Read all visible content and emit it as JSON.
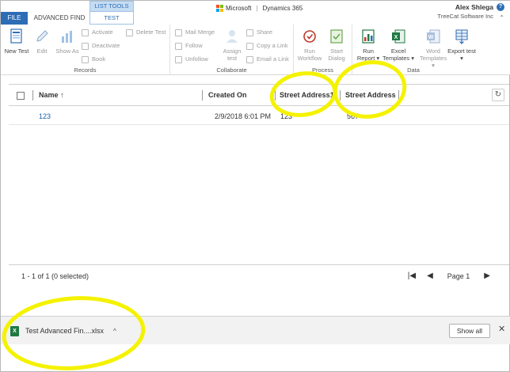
{
  "tabs": {
    "file": "FILE",
    "advanced_find": "ADVANCED FIND",
    "list_tools": "LIST TOOLS",
    "test": "TEST"
  },
  "brand": {
    "company": "Microsoft",
    "product": "Dynamics 365"
  },
  "user": {
    "name": "Alex Shlega",
    "org": "TreeCat Software Inc",
    "help": "?"
  },
  "ribbon": {
    "records": {
      "label": "Records",
      "new": "New Test",
      "edit": "Edit",
      "show_as": "Show As",
      "activate": "Activate",
      "deactivate": "Deactivate",
      "book": "Book",
      "delete": "Delete Test"
    },
    "collaborate": {
      "label": "Collaborate",
      "mail_merge": "Mail Merge",
      "follow": "Follow",
      "unfollow": "Unfollow",
      "assign": "Assign test",
      "share": "Share",
      "copy_link": "Copy a Link",
      "email_link": "Email a Link"
    },
    "process": {
      "label": "Process",
      "run_workflow": "Run Workflow",
      "start_dialog": "Start Dialog"
    },
    "data": {
      "label": "Data",
      "run_report": "Run Report",
      "excel_templates": "Excel Templates",
      "word_templates": "Word Templates",
      "export_test": "Export test"
    }
  },
  "grid": {
    "columns": [
      "Name ↑",
      "Created On",
      "Street Address1",
      "Street Address"
    ],
    "rows": [
      {
        "name": "123",
        "created_on": "2/9/2018 6:01 PM",
        "street1": "123",
        "street2": "567"
      }
    ],
    "status": "1 - 1 of 1 (0 selected)",
    "page": "Page 1"
  },
  "download": {
    "file": "Test Advanced Fin....xlsx",
    "show_all": "Show all",
    "close": "✕"
  },
  "colors": {
    "accent": "#2d6db5",
    "annotation": "#f5f200",
    "excel": "#1f7a43"
  }
}
